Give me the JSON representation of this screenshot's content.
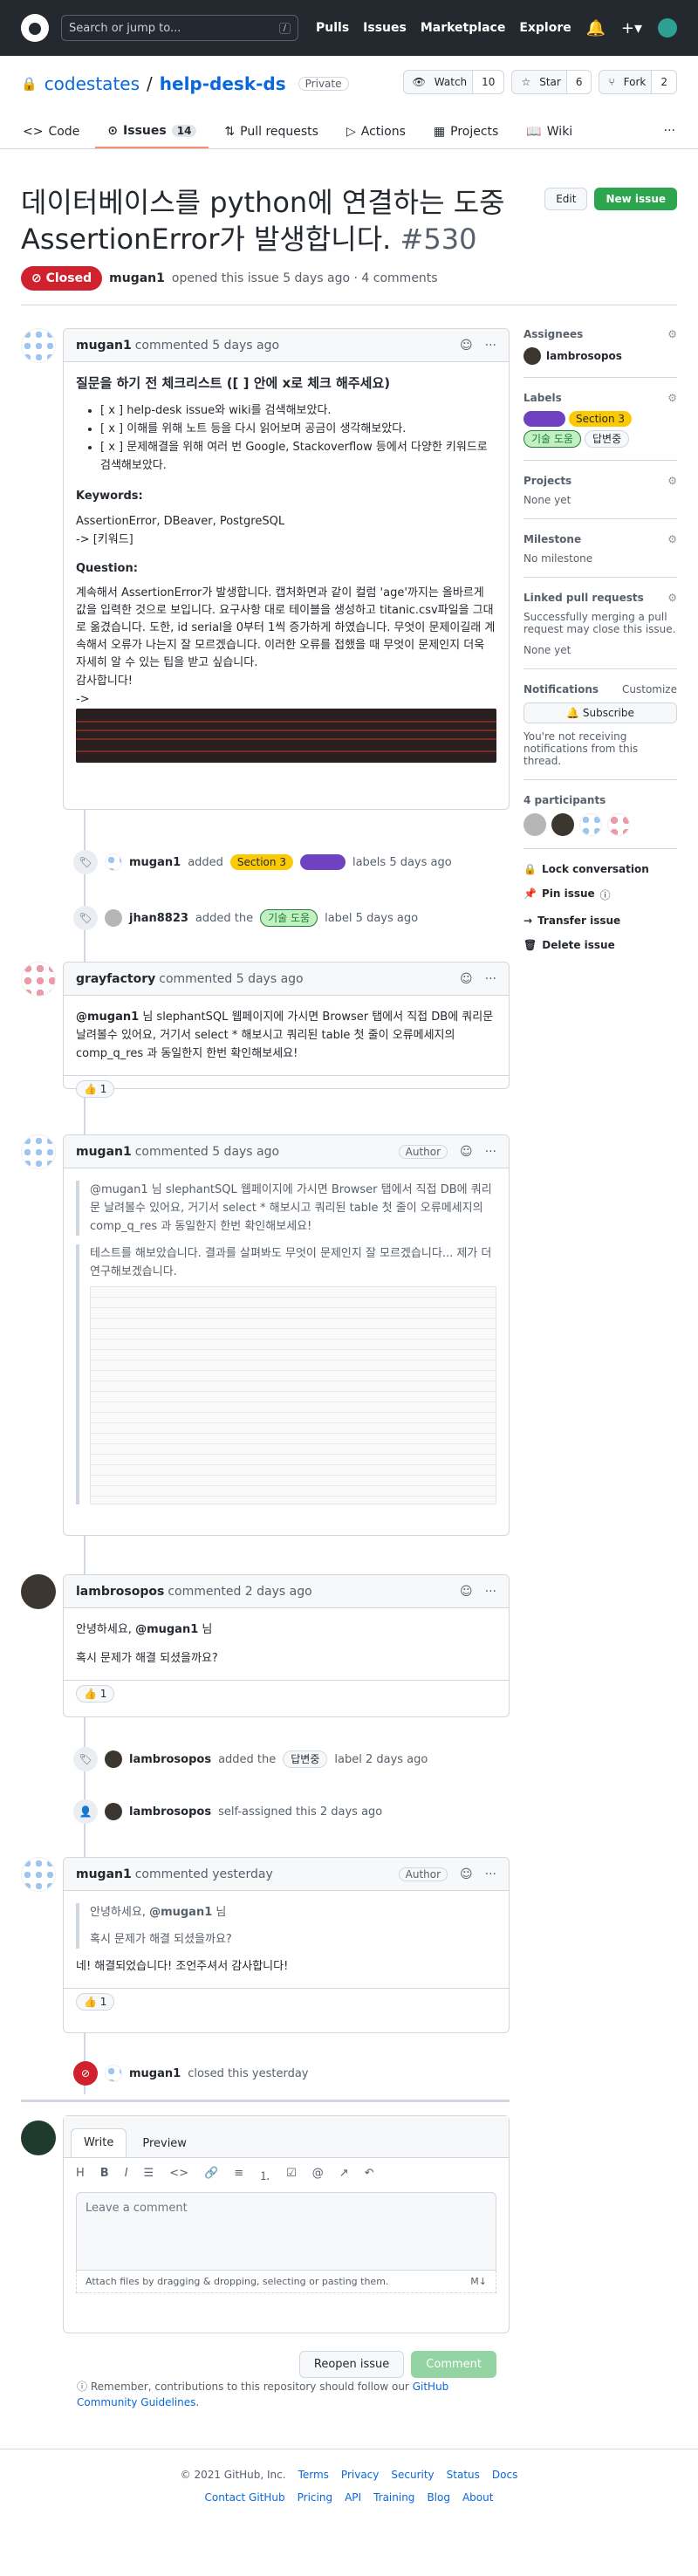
{
  "header": {
    "search_placeholder": "Search or jump to...",
    "slash": "/",
    "nav": [
      "Pulls",
      "Issues",
      "Marketplace",
      "Explore"
    ]
  },
  "repo": {
    "owner": "codestates",
    "sep": "/",
    "name": "help-desk-ds",
    "visibility": "Private",
    "watch": "Watch",
    "watch_count": "10",
    "star": "Star",
    "star_count": "6",
    "fork": "Fork",
    "fork_count": "2"
  },
  "tabs": [
    {
      "label": "Code"
    },
    {
      "label": "Issues",
      "count": "14"
    },
    {
      "label": "Pull requests"
    },
    {
      "label": "Actions"
    },
    {
      "label": "Projects"
    },
    {
      "label": "Wiki"
    }
  ],
  "issue": {
    "title": "데이터베이스를 python에 연결하는 도중 AssertionError가 발생합니다.",
    "number": "#530",
    "state": "Closed",
    "author": "mugan1",
    "meta": "opened this issue 5 days ago · 4 comments",
    "edit": "Edit",
    "new_issue": "New issue"
  },
  "c1": {
    "author": "mugan1",
    "when": "commented 5 days ago",
    "heading": "질문을 하기 전 체크리스트 ([ ] 안에 x로 체크 해주세요)",
    "checks": [
      "[ x ] help-desk issue와 wiki를 검색해보았다.",
      "[ x ] 이해를 위해 노트 등을 다시 읽어보며 공금이 생각해보았다.",
      "[ x ] 문제해결을 위해 여러 번 Google, Stackoverflow 등에서 다양한 키워드로 검색해보았다."
    ],
    "kw_title": "Keywords:",
    "kw": "AssertionError, DBeaver, PostgreSQL",
    "kw2": "-> [키워드]",
    "q_title": "Question:",
    "q": "계속해서 AssertionError가 발생합니다. 캡처화면과 같이 컬럼 'age'까지는 올바르게 값을 입력한 것으로 보입니다. 요구사항 대로 테이블을 생성하고 titanic.csv파일을 그대로 옮겼습니다. 도한, id serial을 0부터 1씩 증가하게 하였습니다. 무엇이 문제이길래 계속해서 오류가 나는지 잘 모르겠습니다. 이러한 오류를 접했을 때 무엇이 문제인지 더욱 자세히 알 수 있는 팁을 받고 싶습니다.",
    "thanks": "감사합니다!",
    "arrow": "->"
  },
  "e1": {
    "user": "mugan1",
    "pre": "added",
    "label1": "Section 3",
    "post": "labels 5 days ago"
  },
  "e2": {
    "user": "jhan8823",
    "pre": "added the",
    "label": "기술 도움",
    "post": "label 5 days ago"
  },
  "c2": {
    "author": "grayfactory",
    "when": "commented 5 days ago",
    "mention": "@mugan1",
    "body": "님 slephantSQL 웹페이지에 가시면 Browser 탭에서 직접 DB에 쿼리문 날려볼수 있어요, 거기서 select * 해보시고 쿼리된 table 첫 줄이 오류메세지의 comp_q_res 과 동일한지 한번 확인해보세요!",
    "react": "👍 1"
  },
  "c3": {
    "author": "mugan1",
    "when": "commented 5 days ago",
    "badge": "Author",
    "quote1": "@mugan1 님 slephantSQL 웹페이지에 가시면 Browser 탭에서 직접 DB에 쿼리문 날려볼수 있어요, 거기서 select * 해보시고 쿼리된 table 첫 줄이 오류메세지의 comp_q_res 과 동일한지 한번 확인해보세요!",
    "quote2": "테스트를 해보았습니다. 결과를 살펴봐도 무엇이 문제인지 잘 모르겠습니다... 제가 더 연구해보겠습니다."
  },
  "c4": {
    "author": "lambrosopos",
    "when": "commented 2 days ago",
    "hello": "안녕하세요,",
    "mention": "@mugan1",
    "hello2": "님",
    "body": "혹시 문제가 해결 되셨을까요?",
    "react": "👍 1"
  },
  "e3": {
    "user": "lambrosopos",
    "pre": "added the",
    "label": "답변중",
    "post": "label 2 days ago"
  },
  "e4": {
    "user": "lambrosopos",
    "text": "self-assigned this 2 days ago"
  },
  "c5": {
    "author": "mugan1",
    "when": "commented yesterday",
    "badge": "Author",
    "q1": "안녕하세요,",
    "q1m": "@mugan1",
    "q1e": "님",
    "q2": "혹시 문제가 해결 되셨을까요?",
    "body": "네! 해결되었습니다! 조언주셔서 감사합니다!",
    "react": "👍 1"
  },
  "e5": {
    "user": "mugan1",
    "text": "closed this yesterday"
  },
  "editor": {
    "write": "Write",
    "preview": "Preview",
    "placeholder": "Leave a comment",
    "attach": "Attach files by dragging & dropping, selecting or pasting them.",
    "reopen": "Reopen issue",
    "comment": "Comment",
    "note": "Remember, contributions to this repository should follow our",
    "link": "GitHub Community Guidelines."
  },
  "sidebar": {
    "assignees": "Assignees",
    "assignee": "lambrosopos",
    "labels": "Labels",
    "label_list": [
      "Section 3",
      "기술 도움",
      "답변중"
    ],
    "projects": "Projects",
    "projects_val": "None yet",
    "milestone": "Milestone",
    "milestone_val": "No milestone",
    "linked": "Linked pull requests",
    "linked_desc": "Successfully merging a pull request may close this issue.",
    "linked_val": "None yet",
    "notif": "Notifications",
    "customize": "Customize",
    "subscribe": "Subscribe",
    "notif_desc": "You're not receiving notifications from this thread.",
    "participants": "4 participants",
    "lock": "Lock conversation",
    "pin": "Pin issue",
    "transfer": "Transfer issue",
    "delete": "Delete issue"
  },
  "footer": {
    "copy": "© 2021 GitHub, Inc.",
    "links1": [
      "Terms",
      "Privacy",
      "Security",
      "Status",
      "Docs"
    ],
    "links2": [
      "Contact GitHub",
      "Pricing",
      "API",
      "Training",
      "Blog",
      "About"
    ]
  }
}
